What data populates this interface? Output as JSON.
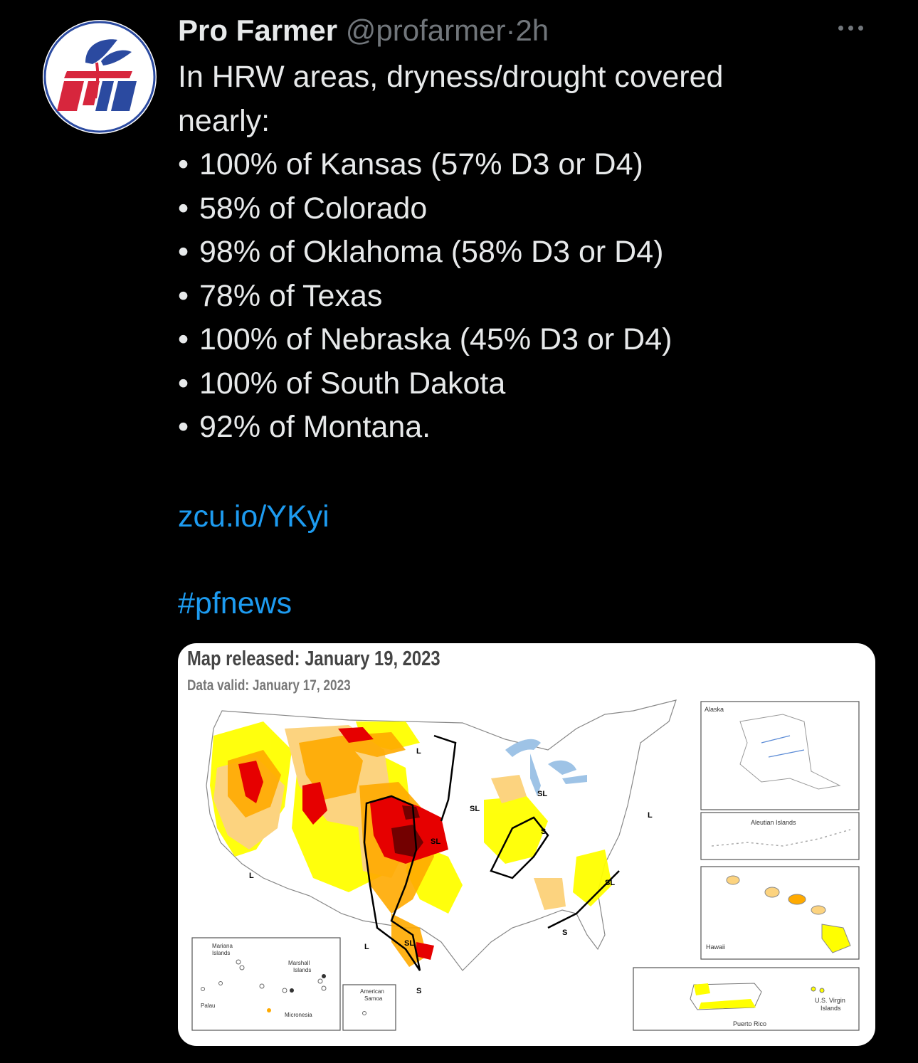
{
  "tweet": {
    "author_name": "Pro Farmer",
    "handle": "@profarmer",
    "separator": "·",
    "time": "2h",
    "intro_lines": [
      "In HRW areas, dryness/drought covered",
      "nearly:"
    ],
    "bullets": [
      "100% of Kansas (57% D3 or D4)",
      "58% of Colorado",
      "98% of Oklahoma (58% D3 or D4)",
      "78% of Texas",
      "100% of Nebraska (45% D3 or D4)",
      "100% of South Dakota",
      "92% of Montana."
    ],
    "bullet_symbol": "•",
    "link": "zcu.io/YKyi",
    "hashtag": "#pfnews"
  },
  "map_card": {
    "title": "Map released: January 19, 2023",
    "subtitle": "Data valid: January 17, 2023",
    "inset_labels": {
      "alaska": "Alaska",
      "aleutian": "Aleutian Islands",
      "hawaii": "Hawaii",
      "puerto_rico": "Puerto Rico",
      "virgin_islands_1": "U.S. Virgin",
      "virgin_islands_2": "Islands",
      "mariana_1": "Mariana",
      "mariana_2": "Islands",
      "marshall_1": "Marshall",
      "marshall_2": "Islands",
      "palau": "Palau",
      "micronesia": "Micronesia",
      "samoa_1": "American",
      "samoa_2": "Samoa"
    },
    "impact_labels": [
      "L",
      "SL",
      "S"
    ],
    "colors": {
      "D0": "#ffff00",
      "D1": "#fcd37f",
      "D2": "#ffaa00",
      "D3": "#e60000",
      "D4": "#730000",
      "water": "#9ec3e6"
    }
  },
  "colors": {
    "link": "#1d9bf0",
    "secondary_text": "#71767b",
    "logo_red": "#d7263d",
    "logo_blue": "#2b4aa0"
  }
}
